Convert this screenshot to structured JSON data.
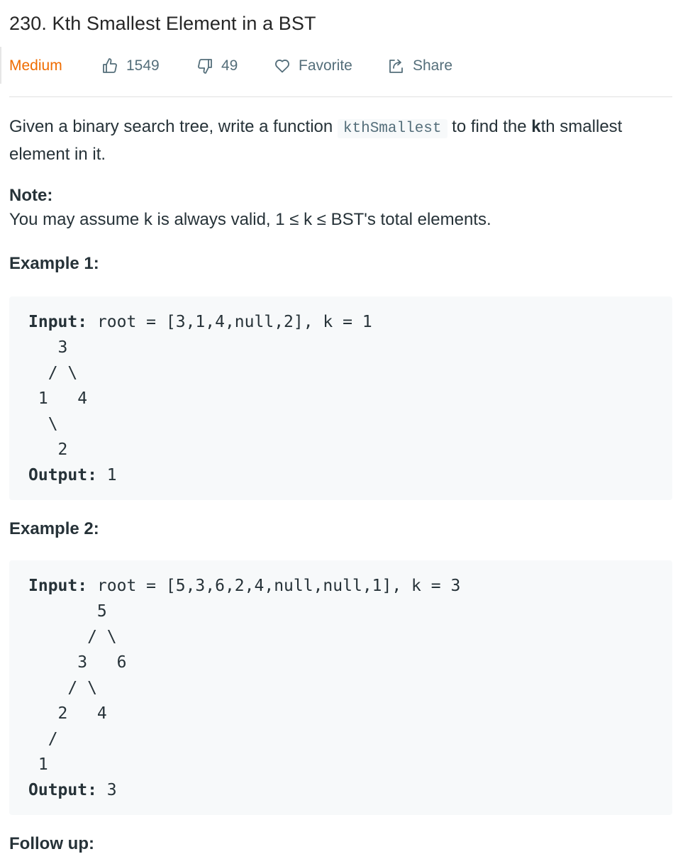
{
  "problem": {
    "title": "230. Kth Smallest Element in a BST",
    "difficulty": "Medium",
    "likes": "1549",
    "dislikes": "49",
    "favorite_label": "Favorite",
    "share_label": "Share"
  },
  "description": {
    "text_before": "Given a binary search tree, write a function ",
    "code": "kthSmallest",
    "text_mid": " to find the ",
    "bold": "k",
    "text_after": "th smallest element in it."
  },
  "note": {
    "heading": "Note:",
    "text": "You may assume k is always valid, 1 ≤ k ≤ BST's total elements."
  },
  "examples": [
    {
      "heading": "Example 1:",
      "input_label": "Input:",
      "input_value": " root = [3,1,4,null,2], k = 1",
      "tree_lines": [
        "   3",
        "  / \\",
        " 1   4",
        "  \\",
        "   2"
      ],
      "output_label": "Output:",
      "output_value": " 1"
    },
    {
      "heading": "Example 2:",
      "input_label": "Input:",
      "input_value": " root = [5,3,6,2,4,null,null,1], k = 3",
      "tree_lines": [
        "       5",
        "      / \\",
        "     3   6",
        "    / \\",
        "   2   4",
        "  /",
        " 1"
      ],
      "output_label": "Output:",
      "output_value": " 3"
    }
  ],
  "follow_up": {
    "heading": "Follow up:"
  },
  "colors": {
    "difficulty_medium": "#ef6c00",
    "meta_text": "#546e7a",
    "code_bg": "#f7f9fa"
  }
}
